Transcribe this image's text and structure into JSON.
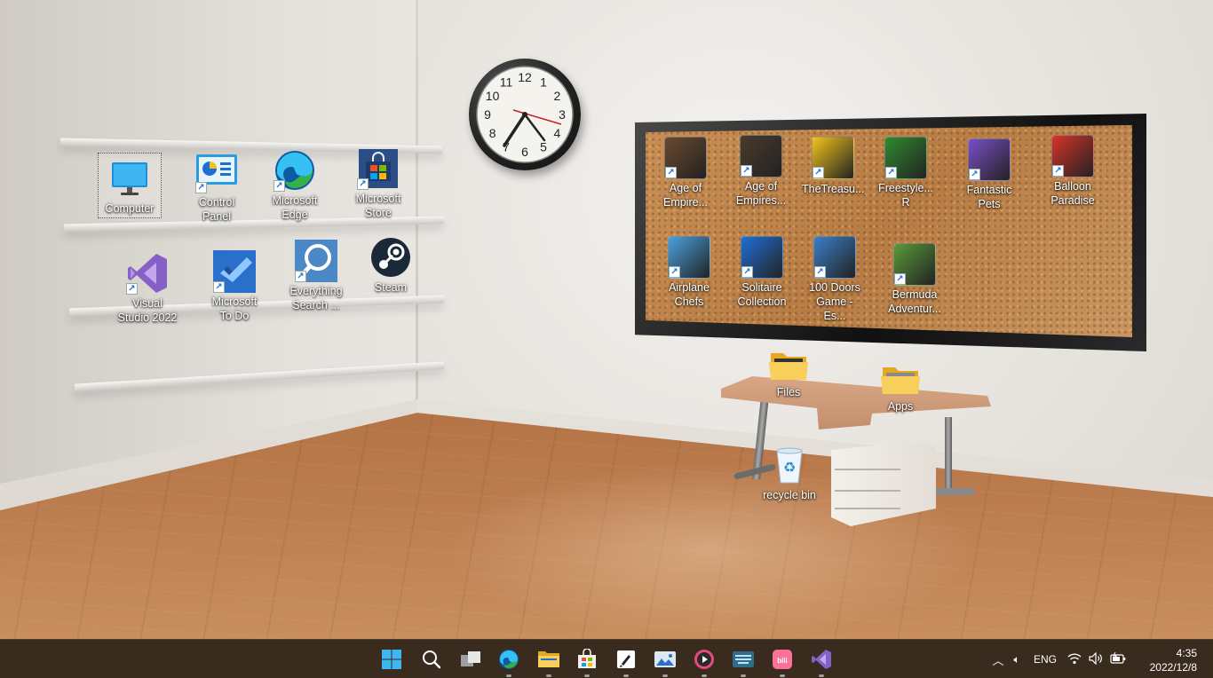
{
  "desktop_icons": {
    "computer": "Computer",
    "control_panel": "Control Panel",
    "edge": "Microsoft Edge",
    "store": "Microsoft Store",
    "visual_studio": "Visual Studio 2022",
    "todo": "Microsoft To Do",
    "everything": "Everything Search ...",
    "steam": "Steam",
    "files": "Files",
    "apps": "Apps",
    "recycle_bin": "recycle bin"
  },
  "board_icons": [
    {
      "label": "Age of Empire...",
      "icon": "age-of-empires-icon",
      "color": "#6b4a2f"
    },
    {
      "label": "Age of Empires...",
      "icon": "age-of-empires-2-icon",
      "color": "#4a3a2a"
    },
    {
      "label": "TheTreasu...",
      "icon": "treasure-4-icon",
      "color": "#f2c318"
    },
    {
      "label": "Freestyle... R",
      "icon": "soccer-ball-icon",
      "color": "#2f8a2f"
    },
    {
      "label": "Fantastic Pets",
      "icon": "fantastic-pets-icon",
      "color": "#7a4ec8"
    },
    {
      "label": "Balloon Paradise",
      "icon": "balloon-paradise-icon",
      "color": "#d8332a"
    },
    {
      "label": "Airplane Chefs",
      "icon": "airplane-chefs-icon",
      "color": "#4aa0e0"
    },
    {
      "label": "Solitaire Collection",
      "icon": "solitaire-icon",
      "color": "#1e6fd8"
    },
    {
      "label": "100 Doors Game - Es...",
      "icon": "100-doors-icon",
      "color": "#3a7fc8"
    },
    {
      "label": "Bermuda Adventur...",
      "icon": "bermuda-adventures-icon",
      "color": "#5a9a3a"
    }
  ],
  "clock_numbers": [
    "12",
    "1",
    "2",
    "3",
    "4",
    "5",
    "6",
    "7",
    "8",
    "9",
    "10",
    "11"
  ],
  "taskbar": {
    "apps": [
      {
        "name": "start-button",
        "icon": "windows-logo-icon"
      },
      {
        "name": "search-button",
        "icon": "search-icon"
      },
      {
        "name": "task-view-button",
        "icon": "task-view-icon"
      },
      {
        "name": "edge-taskbar",
        "icon": "edge-icon"
      },
      {
        "name": "file-explorer-taskbar",
        "icon": "folder-icon"
      },
      {
        "name": "store-taskbar",
        "icon": "store-icon"
      },
      {
        "name": "rocket-app-taskbar",
        "icon": "rocket-icon"
      },
      {
        "name": "photos-taskbar",
        "icon": "photos-icon"
      },
      {
        "name": "media-player-taskbar",
        "icon": "media-player-icon"
      },
      {
        "name": "keyboard-app-taskbar",
        "icon": "keyboard-icon"
      },
      {
        "name": "bilibili-taskbar",
        "icon": "bilibili-icon"
      },
      {
        "name": "visual-studio-taskbar",
        "icon": "visual-studio-icon"
      }
    ],
    "language": "ENG",
    "time": "4:35",
    "date": "2022/12/8"
  },
  "colors": {
    "taskbar_bg": "#3a2b1f",
    "accent_blue": "#1d6fd1",
    "folder_yellow": "#f2c94c"
  }
}
